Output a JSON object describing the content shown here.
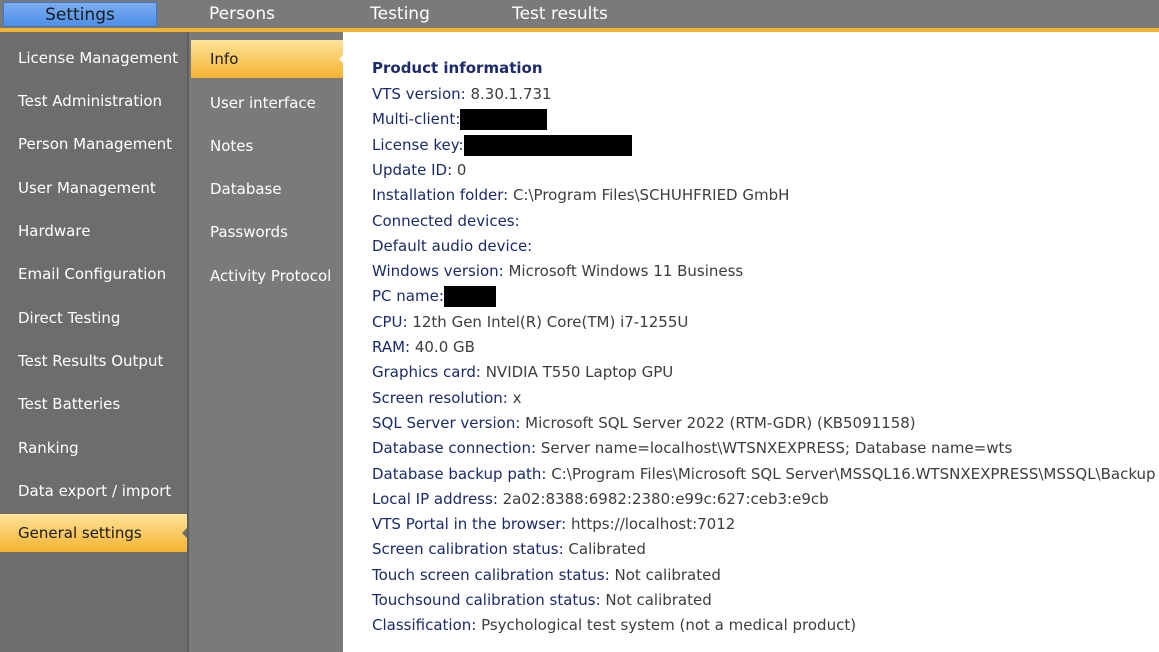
{
  "top_tabs": [
    "Settings",
    "Persons",
    "Testing",
    "Test results"
  ],
  "left_nav": [
    "License Management",
    "Test Administration",
    "Person Management",
    "User Management",
    "Hardware",
    "Email Configuration",
    "Direct Testing",
    "Test Results Output",
    "Test Batteries",
    "Ranking",
    "Data export / import",
    "General settings"
  ],
  "sub_nav": [
    "Info",
    "User interface",
    "Notes",
    "Database",
    "Passwords",
    "Activity Protocol"
  ],
  "info": {
    "heading": "Product information",
    "rows": [
      {
        "label": "VTS version:",
        "value": " 8.30.1.731"
      },
      {
        "label": "Multi-client:",
        "value": "",
        "redacted": true
      },
      {
        "label": "License key:",
        "value": "",
        "redacted": true
      },
      {
        "label": "Update ID:",
        "value": " 0"
      },
      {
        "label": "Installation folder:",
        "value": " C:\\Program Files\\SCHUHFRIED GmbH"
      },
      {
        "label": "Connected devices:",
        "value": ""
      },
      {
        "label": "Default audio device:",
        "value": ""
      },
      {
        "label": "Windows version:",
        "value": " Microsoft Windows 11 Business"
      },
      {
        "label": "PC name:",
        "value": "",
        "redacted": true
      },
      {
        "label": "CPU:",
        "value": " 12th Gen Intel(R) Core(TM) i7-1255U"
      },
      {
        "label": "RAM:",
        "value": " 40.0 GB"
      },
      {
        "label": "Graphics card:",
        "value": " NVIDIA T550 Laptop GPU"
      },
      {
        "label": "Screen resolution:",
        "value": "  x"
      },
      {
        "label": "SQL Server version:",
        "value": " Microsoft SQL Server 2022 (RTM-GDR) (KB5091158)"
      },
      {
        "label": "Database connection:",
        "value": " Server name=localhost\\WTSNXEXPRESS; Database name=wts"
      },
      {
        "label": "Database backup path:",
        "value": " C:\\Program Files\\Microsoft SQL Server\\MSSQL16.WTSNXEXPRESS\\MSSQL\\Backup"
      },
      {
        "label": "Local IP address:",
        "value": " 2a02:8388:6982:2380:e99c:627:ceb3:e9cb"
      },
      {
        "label": "VTS Portal in the browser:",
        "value": " https://localhost:7012"
      },
      {
        "label": "Screen calibration status:",
        "value": " Calibrated"
      },
      {
        "label": "Touch screen calibration status:",
        "value": " Not calibrated"
      },
      {
        "label": "Touchsound calibration status:",
        "value": " Not calibrated"
      },
      {
        "label": "Classification:",
        "value": " Psychological test system (not a medical product)"
      }
    ]
  }
}
